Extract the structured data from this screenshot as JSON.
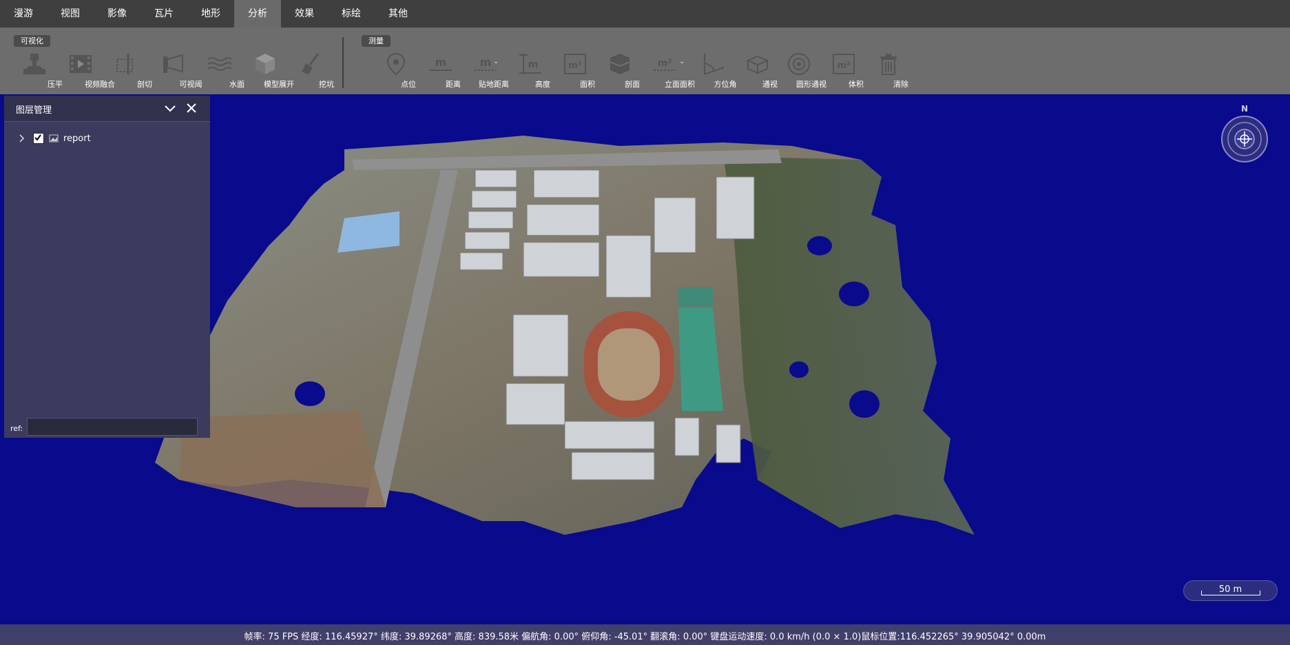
{
  "menu": {
    "items": [
      "漫游",
      "视图",
      "影像",
      "瓦片",
      "地形",
      "分析",
      "效果",
      "标绘",
      "其他"
    ],
    "active_index": 5
  },
  "ribbon": {
    "visualization_group": "可视化",
    "measurement_group": "测量",
    "tools_visual": [
      "压平",
      "视频融合",
      "剖切",
      "可视阈",
      "水面",
      "模型展开",
      "挖坑"
    ],
    "tools_measure": [
      "点位",
      "距离",
      "贴地距离",
      "高度",
      "面积",
      "剖面",
      "立面面积",
      "方位角",
      "通视",
      "圆形通视",
      "体积",
      "清除"
    ],
    "icon_unit_m": "m",
    "icon_unit_m2": "m²"
  },
  "layer_panel": {
    "title": "图层管理",
    "layers": [
      {
        "name": "report",
        "checked": true
      }
    ],
    "ref_label": "ref:",
    "ref_value": ""
  },
  "compass": {
    "north_label": "N"
  },
  "scale": {
    "label": "50 m"
  },
  "status": {
    "text": "帧率: 75 FPS 经度: 116.45927° 纬度: 39.89268° 高度: 839.58米 偏航角: 0.00° 俯仰角: -45.01° 翻滚角: 0.00° 键盘运动速度: 0.0 km/h (0.0 × 1.0)鼠标位置:116.452265° 39.905042° 0.00m"
  },
  "colors": {
    "background": "#0a0a8c",
    "menubar": "#3f3f3f",
    "ribbon": "#6d6d6d",
    "panel": "#3b3b5e",
    "statusbar": "#40406a"
  }
}
